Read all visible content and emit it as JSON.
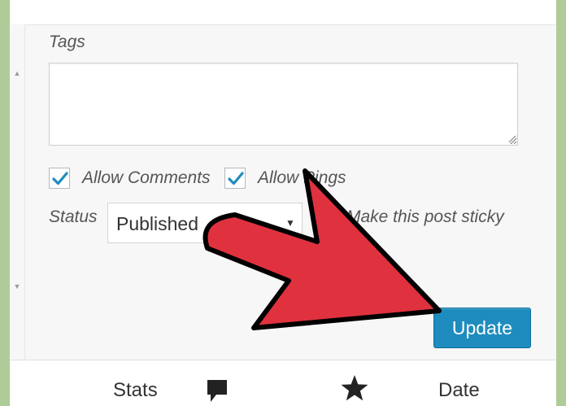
{
  "form": {
    "tags_label": "Tags",
    "tags_value": "",
    "allow_comments_label": "Allow Comments",
    "allow_comments_checked": true,
    "allow_pings_label": "Allow Pings",
    "allow_pings_checked": true,
    "status_label": "Status",
    "status_value": "Published",
    "sticky_label": "Make this post sticky",
    "update_label": "Update"
  },
  "columns": {
    "stats_label": "Stats",
    "comments_icon": "comment-bubble-icon",
    "featured_icon": "star-icon",
    "date_label": "Date"
  },
  "icons": {
    "scroll_up": "scroll-up-arrow",
    "scroll_down": "scroll-down-arrow",
    "status_caret": "chevron-down",
    "annotation": "red-pointer-arrow"
  },
  "colors": {
    "background": "#aecb98",
    "checkbox_check": "#1e8cbe",
    "update_button": "#1e8cbe",
    "annotation_arrow": "#e0313f"
  }
}
